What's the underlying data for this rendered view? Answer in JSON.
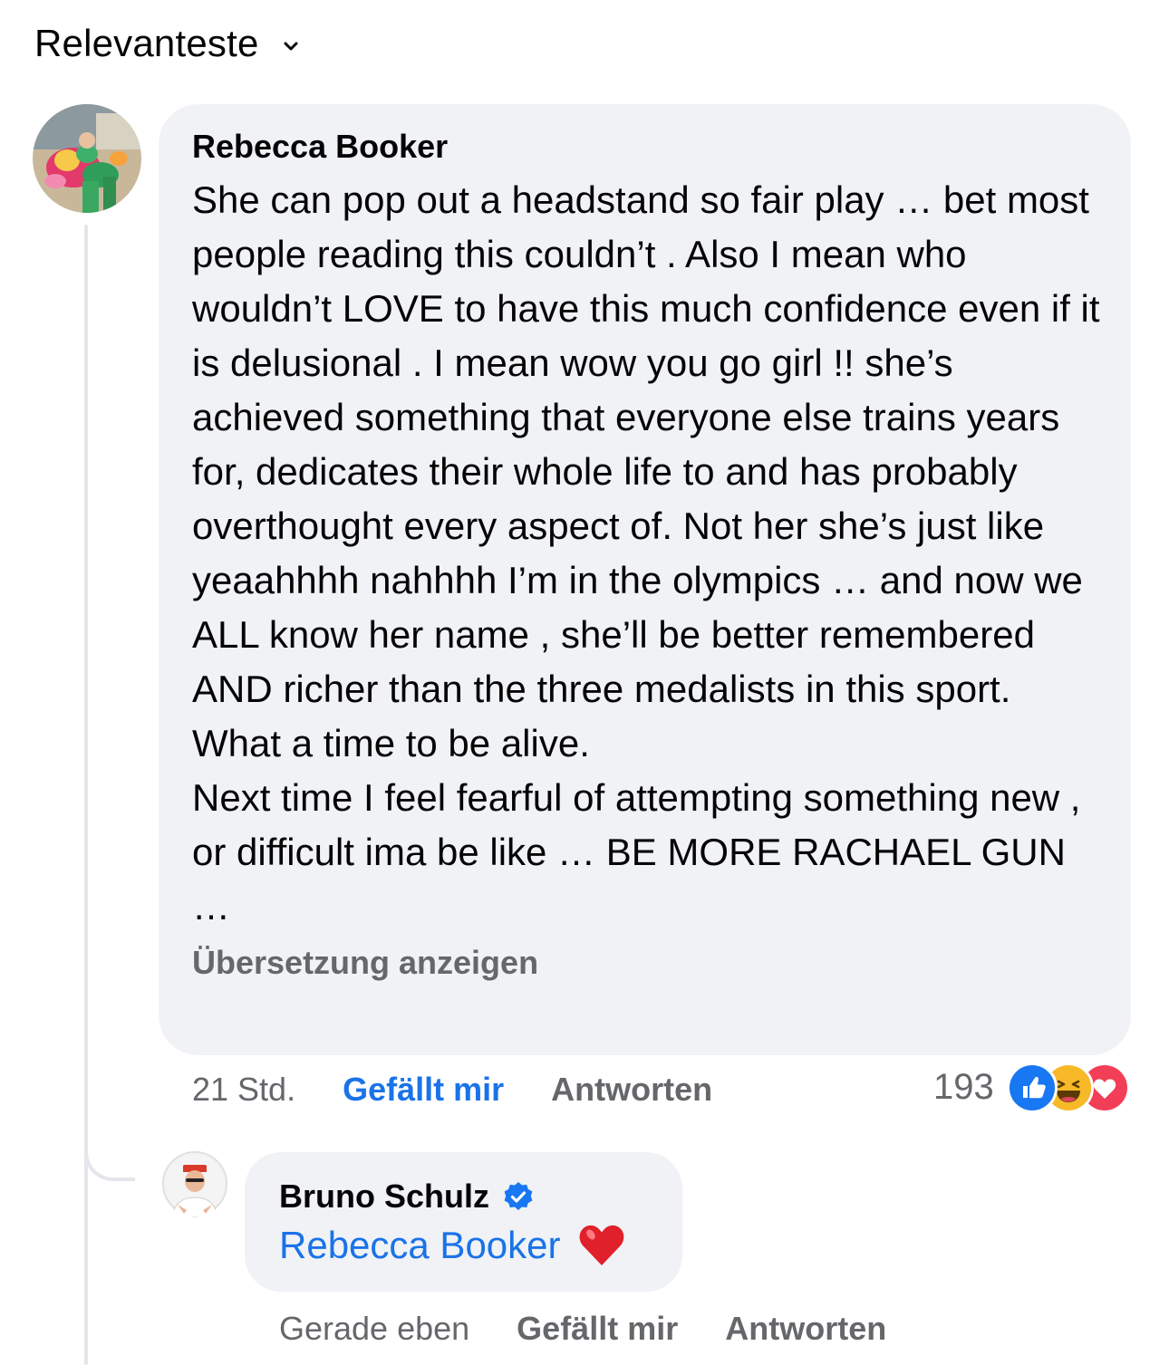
{
  "sort": {
    "label": "Relevanteste",
    "icon": "chevron-down-icon"
  },
  "comment": {
    "author": "Rebecca Booker",
    "text": "She can pop out a headstand so fair play … bet most people reading this couldn’t . Also I mean who wouldn’t LOVE to have this much confidence even if it is delusional . I mean wow you go girl !! she’s achieved something that everyone else trains years for, dedicates their whole life to and has probably overthought every aspect of. Not her she’s just like yeaahhhh nahhhh I’m in the olympics … and now we ALL know her name , she’ll be better remembered AND richer than the three medalists in this sport. What a time to be alive.\nNext time I feel fearful of attempting something new , or difficult ima be like … BE MORE RACHAEL GUN …",
    "translate_label": "Übersetzung anzeigen",
    "time": "21 Std.",
    "like_label": "Gefällt mir",
    "reply_label": "Antworten",
    "reaction_count": "193",
    "reactions": [
      "like-reaction-icon",
      "haha-reaction-icon",
      "love-reaction-icon"
    ]
  },
  "reply": {
    "author": "Bruno Schulz",
    "verified": true,
    "mention": "Rebecca Booker",
    "emoji": "❤️",
    "time": "Gerade eben",
    "like_label": "Gefällt mir",
    "reply_label": "Antworten"
  },
  "colors": {
    "bubble_bg": "#f0f2f5",
    "text": "#050505",
    "secondary": "#65676b",
    "link_blue": "#1a73e8",
    "thread_line": "#e4e6eb"
  }
}
